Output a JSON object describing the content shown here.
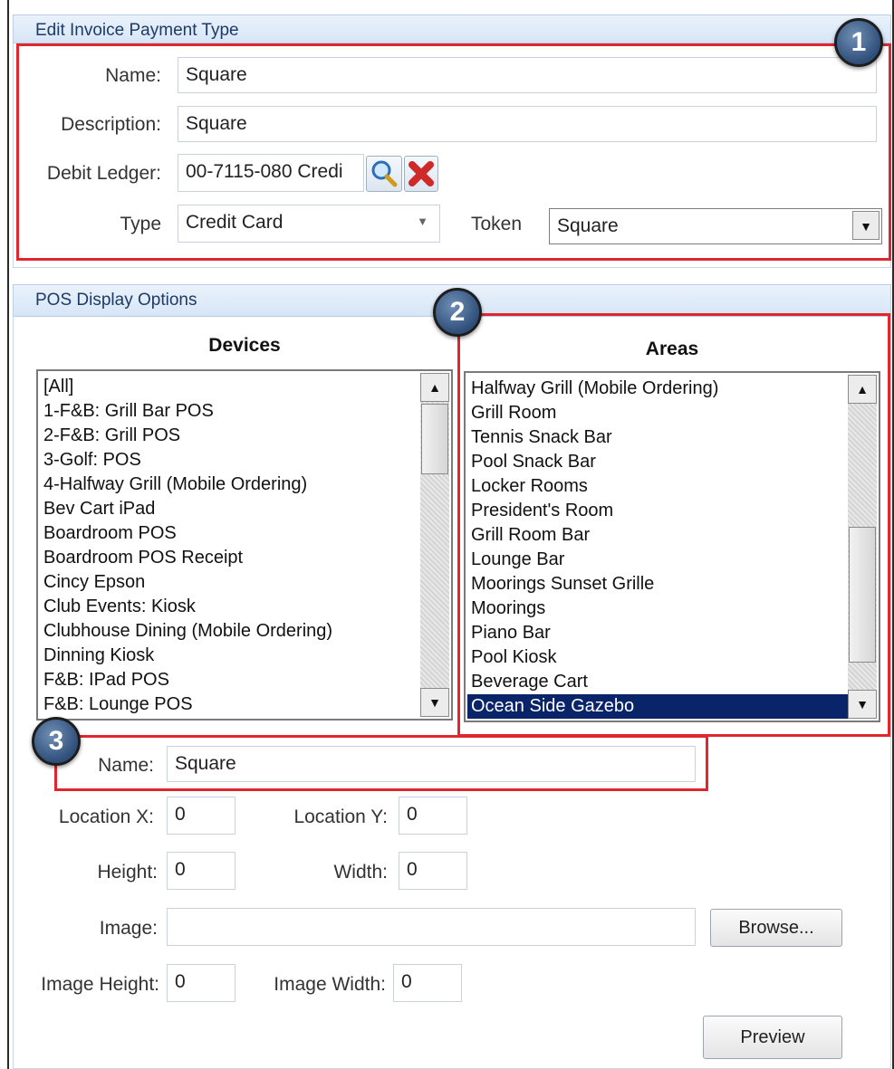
{
  "invoice": {
    "header": "Edit Invoice Payment Type",
    "name_label": "Name:",
    "name_value": "Square",
    "description_label": "Description:",
    "description_value": "Square",
    "debit_ledger_label": "Debit Ledger:",
    "debit_ledger_value": "00-7115-080 Credi",
    "type_label": "Type",
    "type_value": "Credit Card",
    "token_label": "Token",
    "token_value": "Square"
  },
  "pos": {
    "header": "POS Display Options",
    "devices_title": "Devices",
    "areas_title": "Areas",
    "devices": [
      "[All]",
      "1-F&B: Grill Bar POS",
      "2-F&B: Grill POS",
      "3-Golf: POS",
      "4-Halfway Grill (Mobile Ordering)",
      "Bev Cart iPad",
      "Boardroom POS",
      "Boardroom POS Receipt",
      "Cincy Epson",
      "Club Events: Kiosk",
      "Clubhouse Dining (Mobile Ordering)",
      "Dinning Kiosk",
      "F&B: IPad POS",
      "F&B: Lounge POS"
    ],
    "areas": [
      "Halfway Grill (Mobile Ordering)",
      "Grill Room",
      "Tennis Snack Bar",
      "Pool Snack Bar",
      "Locker Rooms",
      "President's Room",
      "Grill Room Bar",
      "Lounge Bar",
      "Moorings Sunset Grille",
      "Moorings",
      "Piano Bar",
      "Pool Kiosk",
      "Beverage Cart",
      "Ocean Side Gazebo"
    ],
    "selected_area": "Ocean Side Gazebo",
    "name_label": "Name:",
    "name_value": "Square",
    "location_x_label": "Location X:",
    "location_x_value": "0",
    "location_y_label": "Location Y:",
    "location_y_value": "0",
    "height_label": "Height:",
    "height_value": "0",
    "width_label": "Width:",
    "width_value": "0",
    "image_label": "Image:",
    "image_value": "",
    "browse_label": "Browse...",
    "image_height_label": "Image Height:",
    "image_height_value": "0",
    "image_width_label": "Image Width:",
    "image_width_value": "0",
    "preview_label": "Preview"
  },
  "badges": [
    "1",
    "2",
    "3"
  ],
  "colors": {
    "callout_red": "#e0262f",
    "selection_navy": "#0a246a",
    "badge_blue": "#2f4f7a"
  },
  "icons": {
    "lookup": "magnifier-icon",
    "clear": "red-x-icon",
    "dropdown": "chevron-down-icon"
  }
}
